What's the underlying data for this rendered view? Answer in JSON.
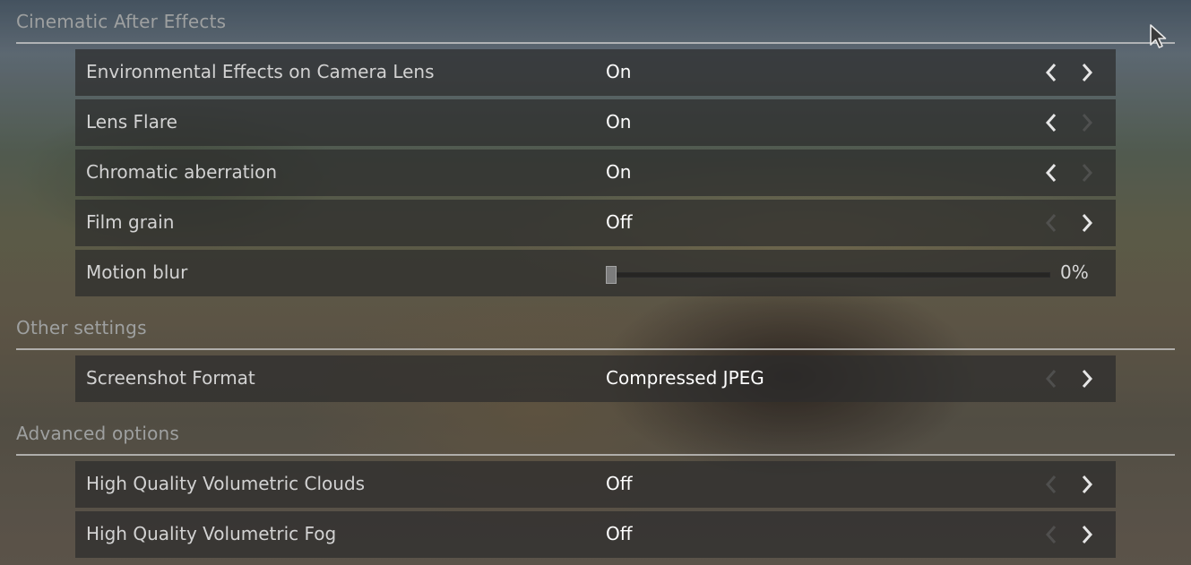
{
  "sections": [
    {
      "title": "Cinematic After Effects",
      "rows": [
        {
          "label": "Environmental Effects on Camera Lens",
          "value": "On",
          "left_arrow": true,
          "right_arrow": true
        },
        {
          "label": "Lens Flare",
          "value": "On",
          "left_arrow": true,
          "right_arrow": false
        },
        {
          "label": "Chromatic aberration",
          "value": "On",
          "left_arrow": true,
          "right_arrow": false
        },
        {
          "label": "Film grain",
          "value": "Off",
          "left_arrow": false,
          "right_arrow": true
        },
        {
          "label": "Motion blur",
          "slider_value": "0%",
          "slider_fraction": 0
        }
      ]
    },
    {
      "title": "Other settings",
      "rows": [
        {
          "label": "Screenshot Format",
          "value": "Compressed JPEG",
          "left_arrow": false,
          "right_arrow": true
        }
      ]
    },
    {
      "title": "Advanced options",
      "rows": [
        {
          "label": "High Quality Volumetric Clouds",
          "value": "Off",
          "left_arrow": false,
          "right_arrow": true
        },
        {
          "label": "High Quality Volumetric Fog",
          "value": "Off",
          "left_arrow": false,
          "right_arrow": true
        }
      ]
    }
  ],
  "icons": {
    "arrow_left": "chevron-left-icon",
    "arrow_right": "chevron-right-icon",
    "cursor": "mouse-pointer-icon"
  },
  "colors": {
    "row_background": "#2c2c2c",
    "header_text": "#9ea0a0",
    "label_text": "#d2d2d2",
    "value_text": "#ffffff",
    "arrow_active": "#e6e6e6",
    "arrow_inactive": "#5a5a5a"
  }
}
